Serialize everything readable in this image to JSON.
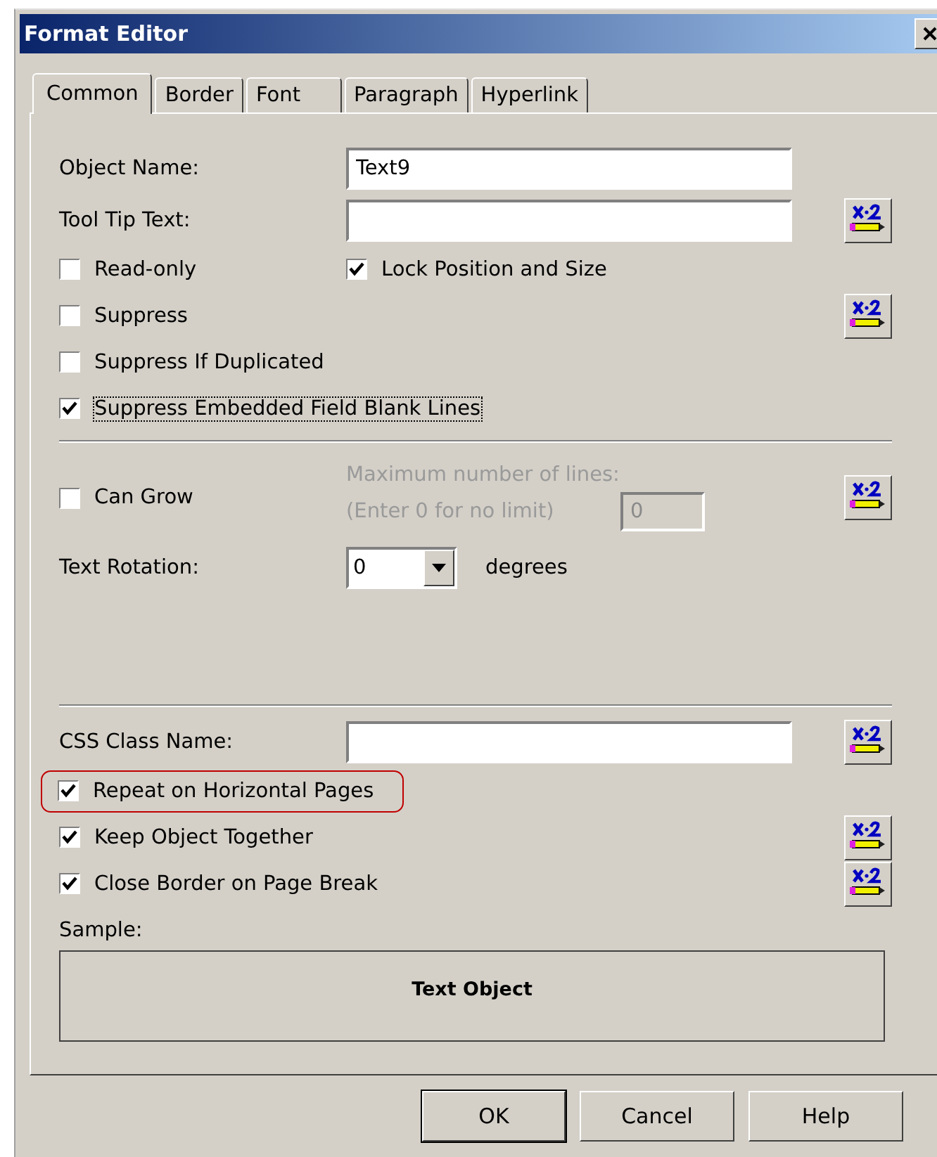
{
  "window": {
    "title": "Format Editor"
  },
  "tabs": [
    {
      "label": "Common",
      "selected": true
    },
    {
      "label": "Border",
      "selected": false
    },
    {
      "label": "Font",
      "selected": false
    },
    {
      "label": "Paragraph",
      "selected": false
    },
    {
      "label": "Hyperlink",
      "selected": false
    }
  ],
  "rows": [
    {
      "kind": "text_field",
      "label": "Object Name:",
      "value": "Text9",
      "formula": false
    },
    {
      "kind": "text_field",
      "label": "Tool Tip Text:",
      "formula": true
    },
    {
      "kind": "checkbox",
      "label": "Read-only",
      "checked": false,
      "formula": false,
      "second": {
        "label": "Lock Position and Size",
        "checked": true
      }
    },
    {
      "kind": "checkbox",
      "label": "Suppress",
      "checked": false,
      "formula": true
    },
    {
      "kind": "checkbox",
      "label": "Suppress If Duplicated",
      "checked": false,
      "formula": false
    },
    {
      "kind": "checkbox",
      "label": "Suppress Embedded Field Blank Lines",
      "checked": true,
      "focused": true,
      "formula": false
    },
    {
      "kind": "separator"
    },
    {
      "kind": "can_grow",
      "label": "Can Grow",
      "checked": false,
      "formula": true,
      "max_lines": {
        "label": "Maximum number of lines:",
        "hint": "(Enter 0 for no limit)",
        "value": "0",
        "disabled": true
      }
    },
    {
      "kind": "dropdown",
      "label": "Text Rotation:",
      "value": "0",
      "unit": "degrees"
    },
    {
      "kind": "separator"
    },
    {
      "kind": "text_field",
      "label": "CSS Class Name:",
      "formula": true
    },
    {
      "kind": "checkbox",
      "label": "Repeat on Horizontal Pages",
      "checked": true,
      "highlighted": true,
      "formula": false
    },
    {
      "kind": "checkbox",
      "label": "Keep Object Together",
      "checked": true,
      "formula": true
    },
    {
      "kind": "checkbox",
      "label": "Close Border on Page Break",
      "checked": true,
      "formula": true
    }
  ],
  "sample": {
    "label": "Sample:",
    "text": "Text Object"
  },
  "buttons": [
    {
      "label": "OK",
      "default": true
    },
    {
      "label": "Cancel",
      "default": false
    },
    {
      "label": "Help",
      "default": false
    }
  ]
}
